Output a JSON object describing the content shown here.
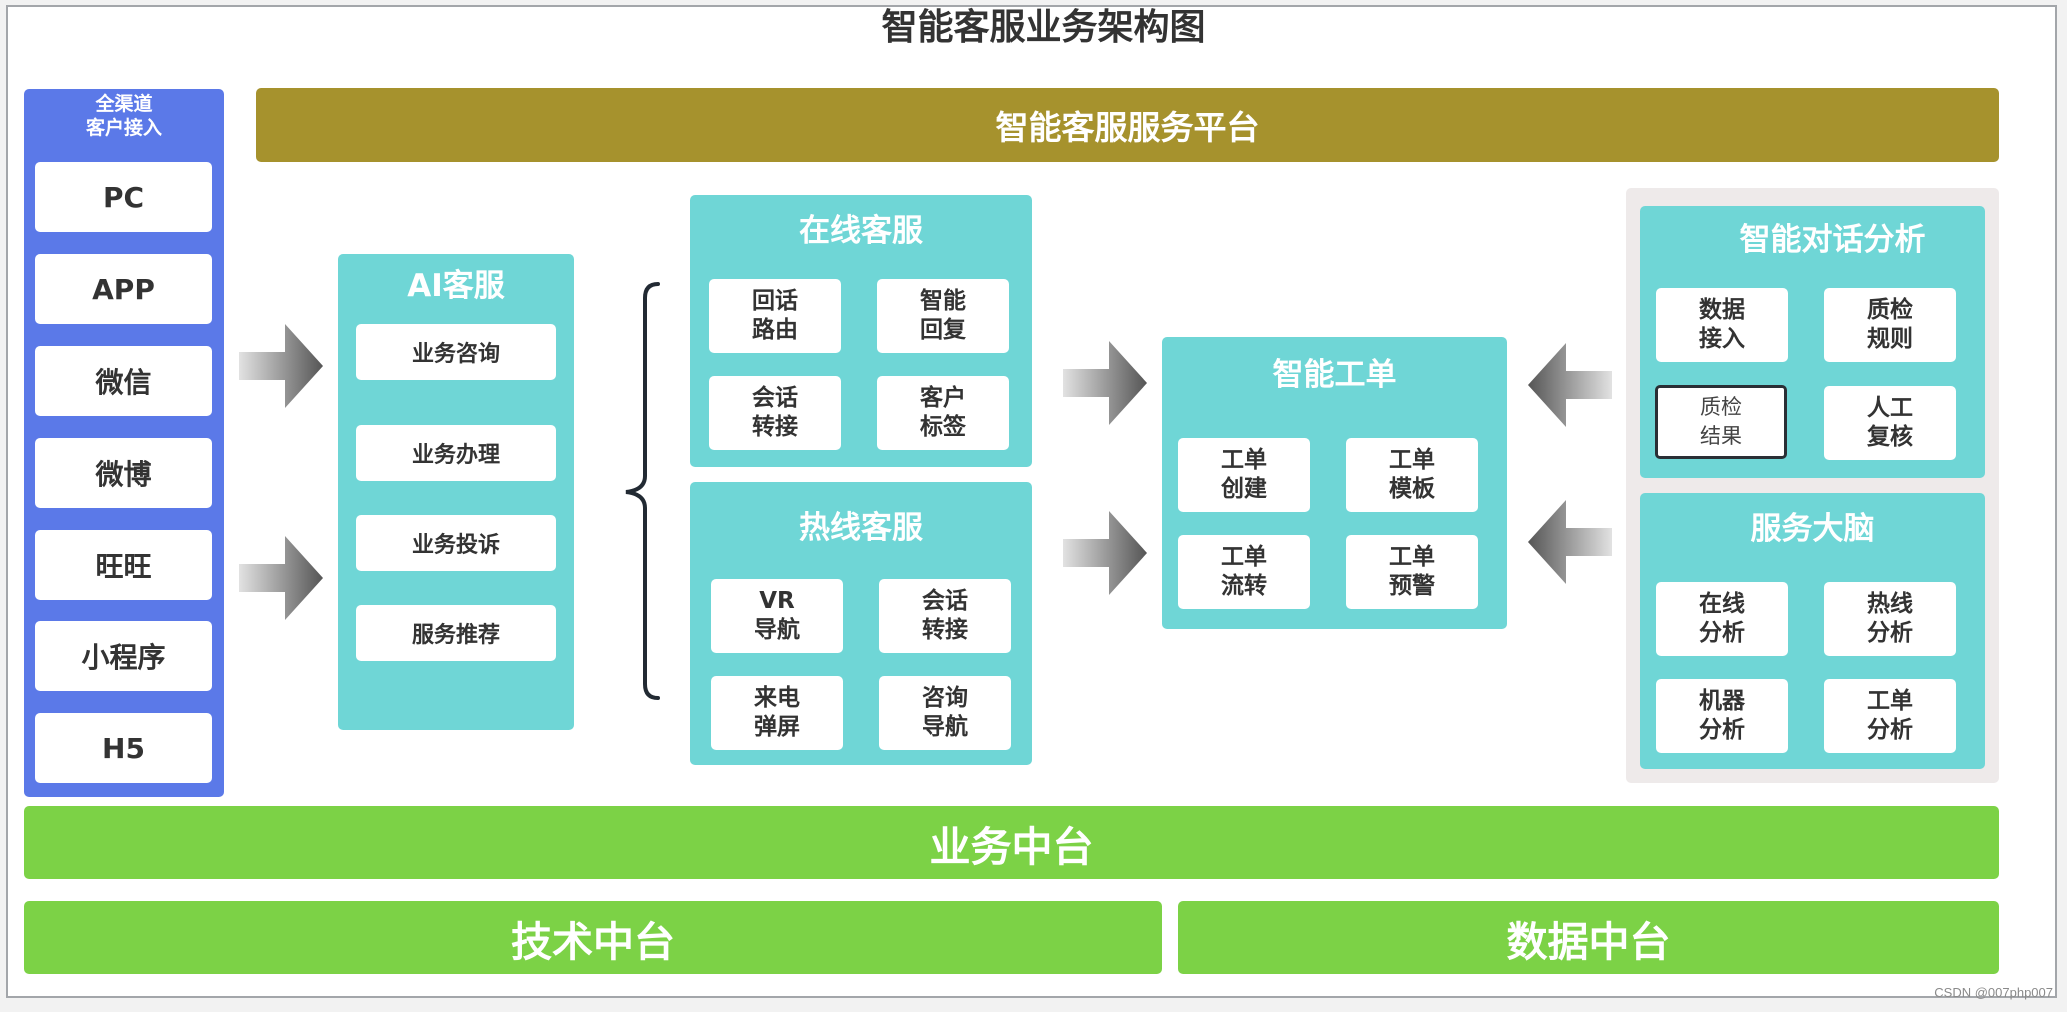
{
  "title": "智能客服业务架构图",
  "channels": {
    "heading": "全渠道\n客户接入",
    "heading_line1": "全渠道",
    "heading_line2": "客户接入",
    "items": [
      "PC",
      "APP",
      "微信",
      "微博",
      "旺旺",
      "小程序",
      "H5"
    ]
  },
  "platform": {
    "label": "智能客服服务平台"
  },
  "ai_service": {
    "title": "AI客服",
    "items": [
      "业务咨询",
      "业务办理",
      "业务投诉",
      "服务推荐"
    ]
  },
  "online_service": {
    "title": "在线客服",
    "items": [
      "回话\n路由",
      "智能\n回复",
      "会话\n转接",
      "客户\n标签"
    ]
  },
  "hotline_service": {
    "title": "热线客服",
    "items": [
      "VR\n导航",
      "会话\n转接",
      "来电\n弹屏",
      "咨询\n导航"
    ]
  },
  "work_order": {
    "title": "智能工单",
    "items": [
      "工单\n创建",
      "工单\n模板",
      "工单\n流转",
      "工单\n预警"
    ]
  },
  "dialog_analysis": {
    "title": "智能对话分析",
    "items": [
      "数据\n接入",
      "质检\n规则",
      "质检\n结果",
      "人工\n复核"
    ],
    "highlighted_item": "质检\n结果"
  },
  "service_brain": {
    "title": "服务大脑",
    "items": [
      "在线\n分析",
      "热线\n分析",
      "机器\n分析",
      "工单\n分析"
    ]
  },
  "foundation": {
    "business": "业务中台",
    "technology": "技术中台",
    "data": "数据中台"
  },
  "watermark": "CSDN @007php007",
  "colors": {
    "channel_blue": "#5b79e8",
    "platform_olive": "#a6922d",
    "module_teal": "#6fd6d6",
    "foundation_green": "#7cd246",
    "analysis_container_gray": "#eeeaea",
    "text_dark": "#333333"
  },
  "icons": {
    "flow_arrow_right": "gradient-arrow-right",
    "flow_arrow_left": "gradient-arrow-left",
    "group_brace": "curly-brace-left"
  }
}
